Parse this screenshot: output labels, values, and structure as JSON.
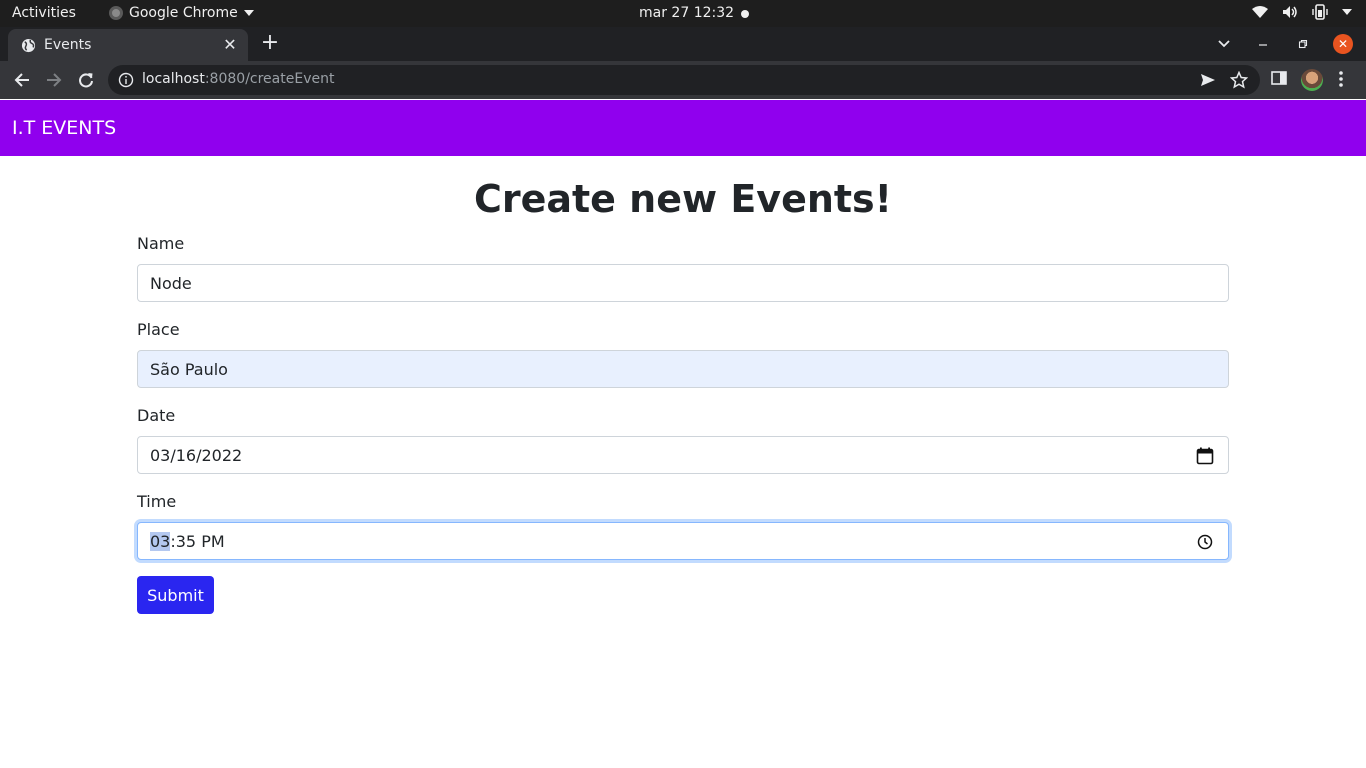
{
  "os": {
    "activities": "Activities",
    "app_name": "Google Chrome",
    "clock": "mar 27  12:32"
  },
  "browser": {
    "tab_title": "Events",
    "url_host": "localhost",
    "url_rest": ":8080/createEvent"
  },
  "navbar": {
    "brand": "I.T EVENTS"
  },
  "page": {
    "heading": "Create new Events!"
  },
  "form": {
    "name_label": "Name",
    "name_value": "Node",
    "place_label": "Place",
    "place_value": "São Paulo",
    "date_label": "Date",
    "date_value": "03/16/2022",
    "time_label": "Time",
    "time_hour": "03",
    "time_rest": ":35 PM",
    "submit_label": "Submit"
  },
  "colors": {
    "navbar": "#9000ee",
    "submit": "#2a26f0",
    "autofill": "#e8f0fe"
  }
}
